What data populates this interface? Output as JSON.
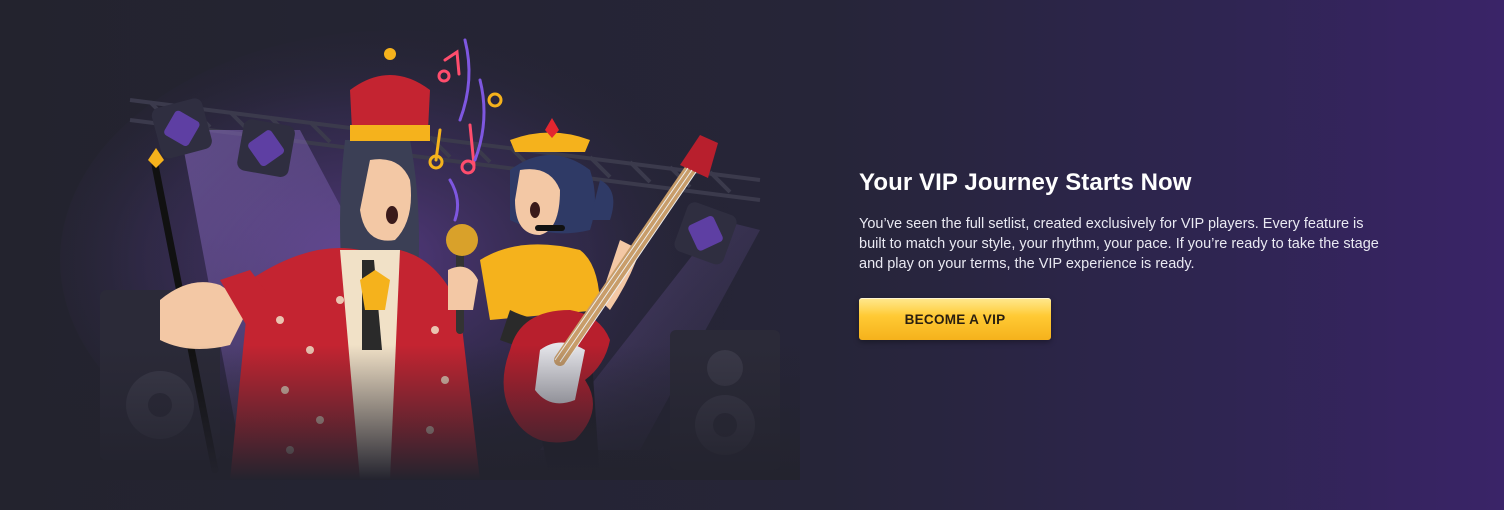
{
  "banner": {
    "title": "Your VIP Journey Starts Now",
    "description": "You’ve seen the full setlist, created exclusively for VIP players. Every feature is built to match your style, your rhythm, your pace. If you’re ready to take the stage and play on your terms, the VIP experience is ready.",
    "cta_label": "BECOME A VIP"
  },
  "colors": {
    "background_left": "#23232e",
    "background_right": "#3a2468",
    "button": "#ffc933",
    "button_text": "#2a1f10",
    "title": "#ffffff"
  },
  "illustration": {
    "subject": "vip-rockstars-illustration"
  }
}
